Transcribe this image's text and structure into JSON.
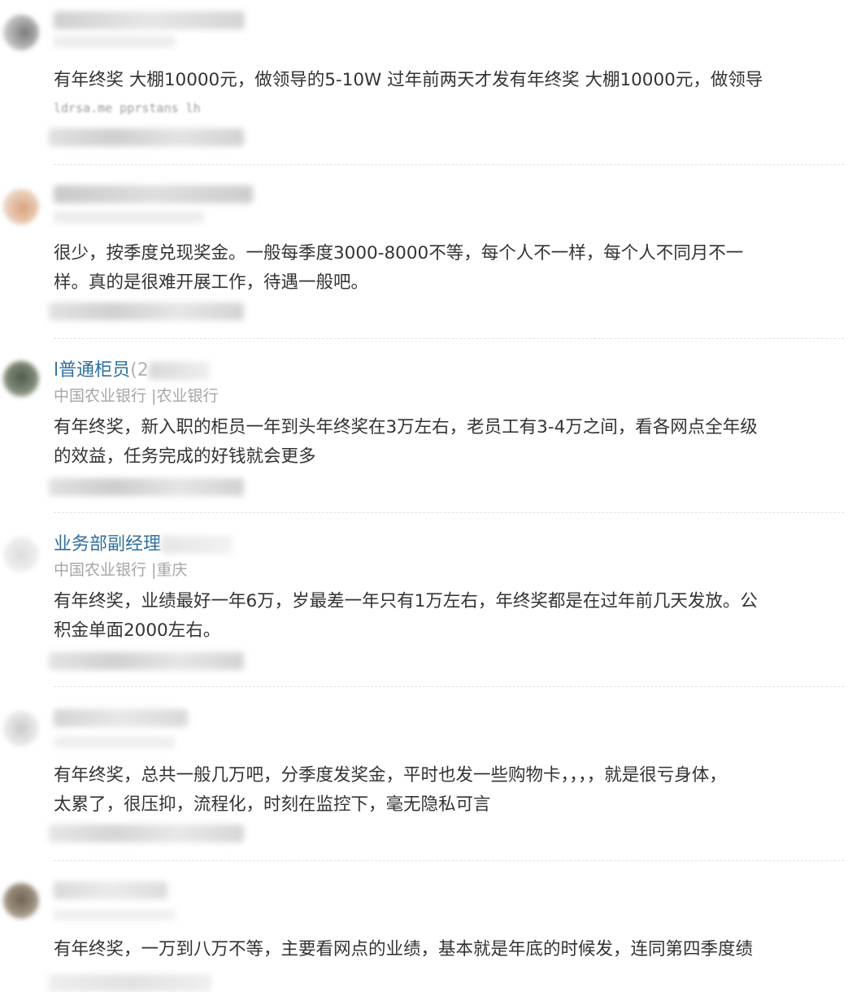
{
  "comments": [
    {
      "text_lines": [
        "有年终奖 大棚10000元，做领导的5-10W 过年前两天才发有年终奖 大棚10000元，做领导"
      ],
      "blurred_caption": "ldrsa.me  pprstans lh"
    },
    {
      "text_lines": [
        "很少，按季度兑现奖金。一般每季度3000-8000不等，每个人不一样，每个人不同月不一",
        "样。真的是很难开展工作，待遇一般吧。"
      ]
    },
    {
      "name": "l普通柜员",
      "name_suffix": "(2",
      "company": "中国农业银行 |农业银行",
      "text_lines": [
        "有年终奖，新入职的柜员一年到头年终奖在3万左右，老员工有3-4万之间，看各网点全年级",
        "的效益，任务完成的好钱就会更多"
      ]
    },
    {
      "name": "业务部副经理",
      "company": "中国农业银行 |重庆",
      "text_lines": [
        "有年终奖，业绩最好一年6万，岁最差一年只有1万左右，年终奖都是在过年前几天发放。公",
        "积金单面2000左右。"
      ]
    },
    {
      "text_lines": [
        "有年终奖，总共一般几万吧，分季度发奖金，平时也发一些购物卡，，，，就是很亏身体，",
        "太累了，很压抑，流程化，时刻在监控下，毫无隐私可言"
      ]
    },
    {
      "text_lines": [
        "有年终奖，一万到八万不等，主要看网点的业绩，基本就是年底的时候发，连同第四季度绩"
      ]
    }
  ]
}
